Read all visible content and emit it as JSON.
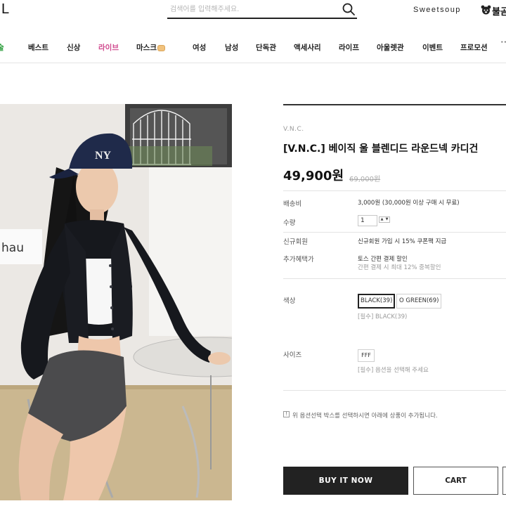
{
  "header": {
    "logo_fragment": "L",
    "search_placeholder": "검색어를 입력해주세요.",
    "brand_link_1": "Sweetsoup",
    "brand_link_2": "불곰"
  },
  "nav": {
    "items": [
      {
        "label": "술"
      },
      {
        "label": "베스트"
      },
      {
        "label": "신상"
      },
      {
        "label": "라이브"
      },
      {
        "label": "마스크"
      },
      {
        "label": "여성"
      },
      {
        "label": "남성"
      },
      {
        "label": "단독관"
      },
      {
        "label": "액세사리"
      },
      {
        "label": "라이프"
      },
      {
        "label": "아울렛관"
      },
      {
        "label": "이벤트"
      },
      {
        "label": "프로모션"
      }
    ],
    "more": "⋯"
  },
  "product": {
    "brand": "V.N.C.",
    "title": "[V.N.C.] 베이직 울 블렌디드 라운드넥 카디건",
    "price": "49,900원",
    "original_price": "69,000원",
    "rows": {
      "shipping_label": "배송비",
      "shipping_value": "3,000원 (30,000원 이상 구매 시 무료)",
      "qty_label": "수량",
      "qty_value": "1",
      "member_label": "신규회원",
      "member_value": "신규회원 가입 시 15% 쿠폰팩 지급",
      "benefit_label": "추가혜택가",
      "benefit_value_1": "토스 간편 결제 할인",
      "benefit_value_2": "간편 결제 시 최대 12% 중복할인",
      "color_label": "색상",
      "color_options": [
        "BLACK(39)",
        "O GREEN(69)"
      ],
      "color_selected_note": "[필수] BLACK(39)",
      "size_label": "사이즈",
      "size_option": "FFF",
      "size_note": "[필수] 옵션을 선택해 주세요"
    },
    "notice": "위 옵션선택 박스를 선택하시면 아래에 상품이 추가됩니다.",
    "buy_now": "BUY IT NOW",
    "cart": "CART"
  },
  "colors": {
    "accent_dark": "#222222",
    "live_pink": "#d14b8f",
    "first_green": "#2a9d3a"
  }
}
